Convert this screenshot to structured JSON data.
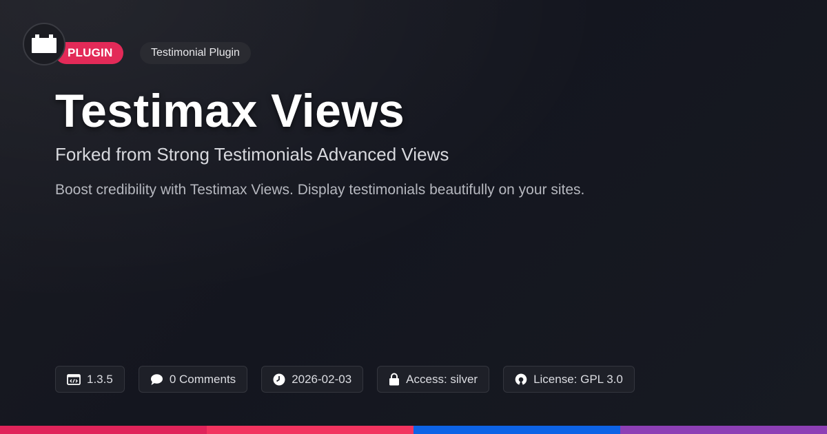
{
  "header": {
    "logo_icon": "plugin-block-icon",
    "type_badge": "PLUGIN",
    "category_badge": "Testimonial Plugin"
  },
  "main": {
    "title": "Testimax Views",
    "subtitle": "Forked from Strong Testimonials Advanced Views",
    "description": "Boost credibility with Testimax Views. Display testimonials beautifully on your sites."
  },
  "meta": [
    {
      "icon": "code-window-icon",
      "label": "1.3.5"
    },
    {
      "icon": "comment-bubble-icon",
      "label": "0 Comments"
    },
    {
      "icon": "clock-icon",
      "label": "2026-02-03"
    },
    {
      "icon": "lock-icon",
      "label": "Access: silver"
    },
    {
      "icon": "open-source-icon",
      "label": "License: GPL 3.0"
    }
  ],
  "colors": {
    "accent": "#e32a58",
    "bar": [
      "#e0245a",
      "#f2345f",
      "#0d63e6",
      "#8d3fb5"
    ]
  }
}
